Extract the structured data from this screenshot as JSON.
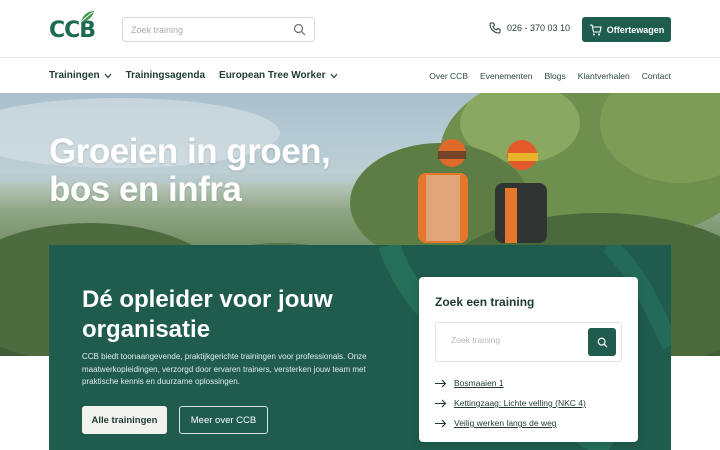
{
  "header": {
    "logo_text": "CCB",
    "search_placeholder": "Zoek training",
    "phone": "026 - 370 03 10",
    "cart_label": "Offertewagen"
  },
  "nav": {
    "left": [
      {
        "label": "Trainingen",
        "dropdown": true
      },
      {
        "label": "Trainingsagenda",
        "dropdown": false
      },
      {
        "label": "European Tree Worker",
        "dropdown": true
      }
    ],
    "right": [
      "Over CCB",
      "Evenementen",
      "Blogs",
      "Klantverhalen",
      "Contact"
    ]
  },
  "hero": {
    "title_line1": "Groeien in groen,",
    "title_line2": "bos en infra"
  },
  "panel": {
    "title": "Dé opleider voor jouw organisatie",
    "text": "CCB biedt toonaangevende, praktijkgerichte trainingen voor professionals. Onze maatwerkopleidingen, verzorgd door ervaren trainers, versterken jouw team met praktische kennis en duurzame oplossingen.",
    "btn_primary": "Alle trainingen",
    "btn_secondary": "Meer over CCB"
  },
  "card": {
    "title": "Zoek een training",
    "search_placeholder": "Zoek training",
    "links": [
      "Bosmaaien 1",
      "Kettingzaag: Lichte velling (NKC 4)",
      "Veilig werken langs de weg"
    ]
  },
  "colors": {
    "brand_green": "#1f5c4e",
    "logo_green": "#1d6a52",
    "hero_text": "#ffffff"
  }
}
